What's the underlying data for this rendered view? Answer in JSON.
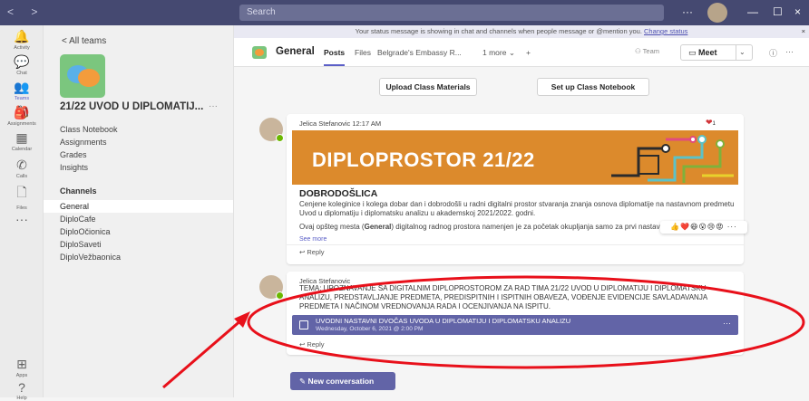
{
  "titlebar": {
    "nav_label": "< >",
    "search_placeholder": "Search",
    "more": "···",
    "minimize": "—",
    "maximize": "☐",
    "close": "×"
  },
  "rail": [
    {
      "label": "Activity",
      "icon": "bell-icon",
      "glyph": "🔔"
    },
    {
      "label": "Chat",
      "icon": "chat-icon",
      "glyph": "💬"
    },
    {
      "label": "Teams",
      "icon": "teams-icon",
      "glyph": "👥"
    },
    {
      "label": "Assignments",
      "icon": "assignments-icon",
      "glyph": "🎒"
    },
    {
      "label": "Calendar",
      "icon": "calendar-icon",
      "glyph": "▦"
    },
    {
      "label": "Calls",
      "icon": "phone-icon",
      "glyph": "✆"
    },
    {
      "label": "Files",
      "icon": "file-icon",
      "glyph": "🗋"
    },
    {
      "label": "",
      "icon": "more-icon",
      "glyph": "···"
    },
    {
      "label": "Apps",
      "icon": "apps-icon",
      "glyph": "⊞"
    },
    {
      "label": "Help",
      "icon": "help-icon",
      "glyph": "?"
    }
  ],
  "team": {
    "back_label": "<  All teams",
    "name": "21/22 UVOD U DIPLOMATIJ...",
    "more": "···",
    "links": [
      "Class Notebook",
      "Assignments",
      "Grades",
      "Insights"
    ],
    "channels_heading": "Channels",
    "channels": [
      "General",
      "DiploCafe",
      "DiploOčionica",
      "DiploSaveti",
      "DiploVežbaonica"
    ]
  },
  "status_message": {
    "text": "Your status message is showing in chat and channels when people message or @mention you.",
    "link": "Change status"
  },
  "channel": {
    "title": "General",
    "tabs": [
      "Posts",
      "Files",
      "Belgrade's Embassy R...",
      "1 more ⌄",
      "+"
    ],
    "team_button": "Team",
    "meet_button": "Meet",
    "meet_chevron": "⌄",
    "info": "ⓘ",
    "more": "···"
  },
  "actions": {
    "upload": "Upload Class Materials",
    "notebook": "Set up Class Notebook"
  },
  "post1": {
    "author": "Jelica Stefanovic",
    "time": "12:17 AM",
    "banner_title": "DIPLOPROSTOR 21/22",
    "heading": "DOBRODOŠLICA",
    "para1": "Cenjene koleginice i kolega dobar dan i dobrodošli u radni digitalni prostor stvaranja znanja osnova diplomatije na nastavnom predmetu Uvod u diplomatiju i diplomatsku analizu u akademskoj 2021/2022. godni.",
    "para2_a": "Ovaj opšteg mesta (",
    "para2_b": "General",
    "para2_c": ") digitalnog radnog prostora namenjen je za početak okupljanja samo za prvi nastavni video",
    "see_more": "See more",
    "reply": "↩ Reply",
    "reaction_count": "1",
    "reaction_bar": "👍❤️😆😮😢😡 ···"
  },
  "post2": {
    "author": "Jelica Stefanovic",
    "text": "Tema: Upoznavanje sa digitalnim diploprostorom za rad tima 21/22 Uvod u diplomatiju i diplomatsku analizu, predstavljanje predmeta, predispitnih i ispitnih obaveza, vođenje evidencije savladavanja predmeta i načinom vrednovanja rada i ocenjivanja na ispitu.",
    "event_title": "Uvodni nastavni dvočas uvoda u diplomatiju i diplomatsku analizu",
    "event_date": "Wednesday, October 6, 2021 @ 2:00 PM",
    "event_more": "···",
    "reply": "↩ Reply"
  },
  "new_conversation": "✎  New conversation",
  "colors": {
    "titlebar": "#454971",
    "accent": "#5b5fc7",
    "event": "#6264a7",
    "banner": "#dc8a2c",
    "annotation": "#e8101a"
  }
}
